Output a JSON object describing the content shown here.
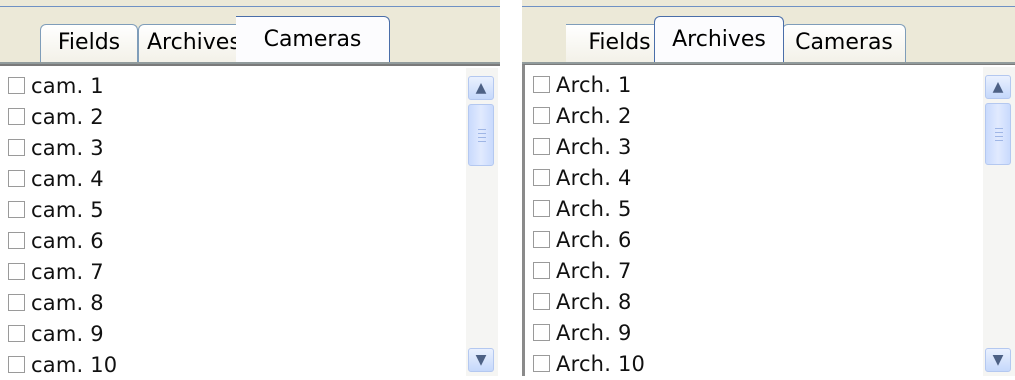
{
  "left_panel": {
    "tabs": [
      {
        "label": "Fields",
        "selected": false
      },
      {
        "label": "Archives",
        "selected": false
      },
      {
        "label": "Cameras",
        "selected": true
      }
    ],
    "items": [
      "cam. 1",
      "cam. 2",
      "cam. 3",
      "cam. 4",
      "cam. 5",
      "cam. 6",
      "cam. 7",
      "cam. 8",
      "cam. 9",
      "cam. 10"
    ]
  },
  "right_panel": {
    "tabs": [
      {
        "label": "Fields",
        "selected": false
      },
      {
        "label": "Archives",
        "selected": true
      },
      {
        "label": "Cameras",
        "selected": false
      }
    ],
    "items": [
      "Arch. 1",
      "Arch. 2",
      "Arch. 3",
      "Arch. 4",
      "Arch. 5",
      "Arch. 6",
      "Arch. 7",
      "Arch. 8",
      "Arch. 9",
      "Arch. 10"
    ]
  },
  "scrollbar": {
    "up_icon": "scroll-up-arrow",
    "down_icon": "scroll-down-arrow"
  },
  "colors": {
    "tab_border": "#7f9db9",
    "scroll_thumb": "#c9dafd",
    "window_bg": "#ece9d8"
  }
}
